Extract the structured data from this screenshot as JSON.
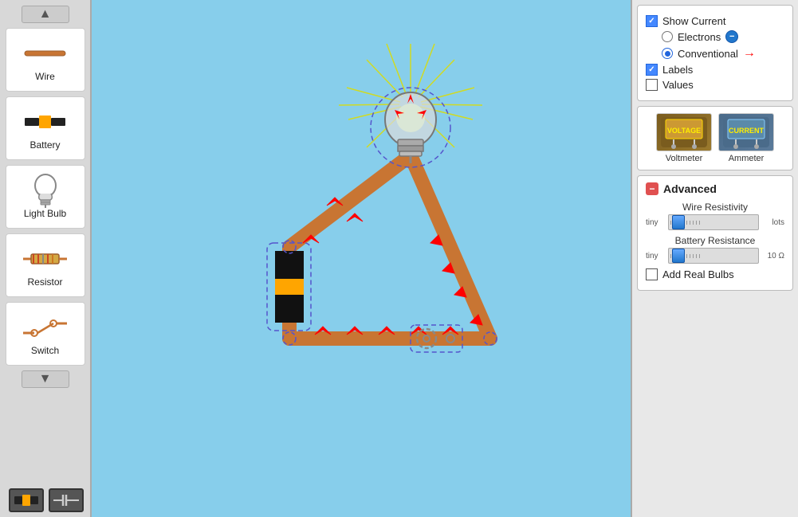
{
  "sidebar": {
    "scroll_up_icon": "▲",
    "scroll_down_icon": "▼",
    "items": [
      {
        "id": "wire",
        "label": "Wire"
      },
      {
        "id": "battery",
        "label": "Battery"
      },
      {
        "id": "light-bulb",
        "label": "Light Bulb"
      },
      {
        "id": "resistor",
        "label": "Resistor"
      },
      {
        "id": "switch",
        "label": "Switch"
      }
    ]
  },
  "right_panel": {
    "show_current": {
      "label": "Show Current",
      "checked": true
    },
    "electrons": {
      "label": "Electrons",
      "selected": false
    },
    "conventional": {
      "label": "Conventional",
      "selected": true
    },
    "labels": {
      "label": "Labels",
      "checked": true
    },
    "values": {
      "label": "Values",
      "checked": false
    },
    "instruments": [
      {
        "id": "voltmeter",
        "label": "Voltmeter"
      },
      {
        "id": "ammeter",
        "label": "Ammeter"
      }
    ],
    "advanced": {
      "title": "Advanced",
      "wire_resistivity": {
        "title": "Wire Resistivity",
        "min_label": "tiny",
        "max_label": "lots",
        "value": 0.05
      },
      "battery_resistance": {
        "title": "Battery Resistance",
        "min_label": "tiny",
        "max_label": "10 Ω",
        "value": 0.05
      },
      "add_real_bulbs": {
        "label": "Add Real Bulbs",
        "checked": false
      }
    }
  }
}
